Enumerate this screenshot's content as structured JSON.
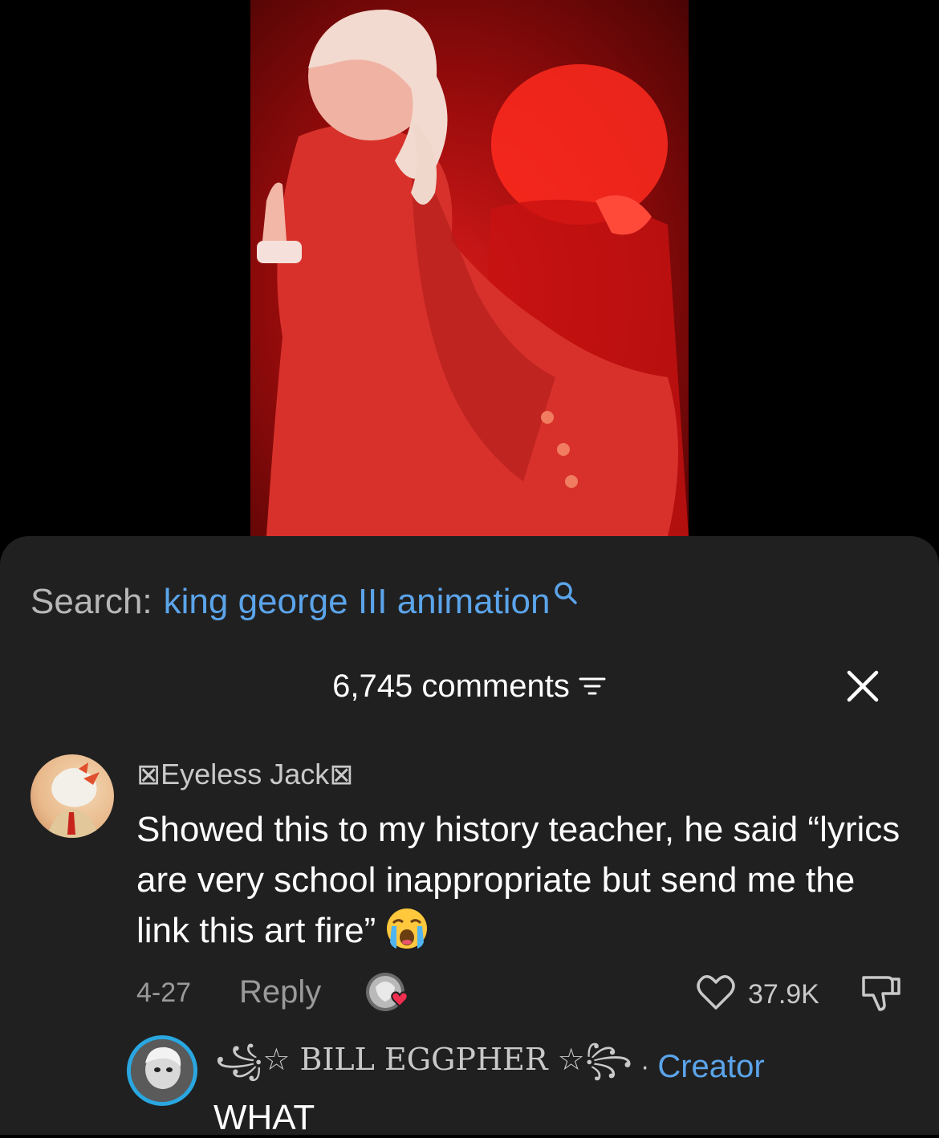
{
  "colors": {
    "sheet_background": "#202020",
    "link_blue": "#5ba4ea",
    "muted_text": "#9a9a9a",
    "creator_ring": "#2aa7e0"
  },
  "search": {
    "prefix": "Search:",
    "query": "king george III animation",
    "icon": "search-icon"
  },
  "comments_panel": {
    "count_label": "6,745 comments",
    "sort_icon": "sort-icon",
    "close_icon": "close-icon"
  },
  "comment": {
    "username": "⊠Eyeless Jack⊠",
    "text": "Showed this to my history teacher, he said “lyrics are very school inappropriate but send me the link this art fire”",
    "emoji": "loudly-crying-face",
    "date": "4-27",
    "reply_label": "Reply",
    "likes": "37.9K",
    "liked_by_creator": true
  },
  "reply": {
    "username": "꧁☆ BILL EGGPHER ☆꧂",
    "separator": "·",
    "badge": "Creator",
    "text": "WHAT"
  }
}
